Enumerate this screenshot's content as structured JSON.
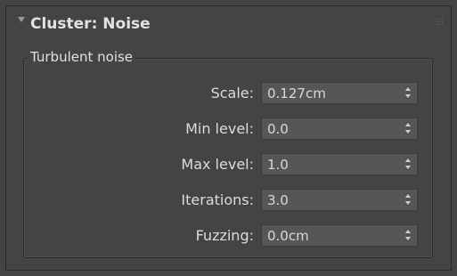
{
  "rollout": {
    "title": "Cluster: Noise",
    "collapse_icon": "triangle-down-icon",
    "grip_icon": "dot-grid-icon"
  },
  "group": {
    "title": "Turbulent noise"
  },
  "fields": [
    {
      "label": "Scale:",
      "value": "0.127cm"
    },
    {
      "label": "Min level:",
      "value": "0.0"
    },
    {
      "label": "Max level:",
      "value": "1.0"
    },
    {
      "label": "Iterations:",
      "value": "3.0"
    },
    {
      "label": "Fuzzing:",
      "value": "0.0cm"
    }
  ],
  "colors": {
    "background": "#444444",
    "field_background": "#565656",
    "text": "#dcdcdc"
  }
}
